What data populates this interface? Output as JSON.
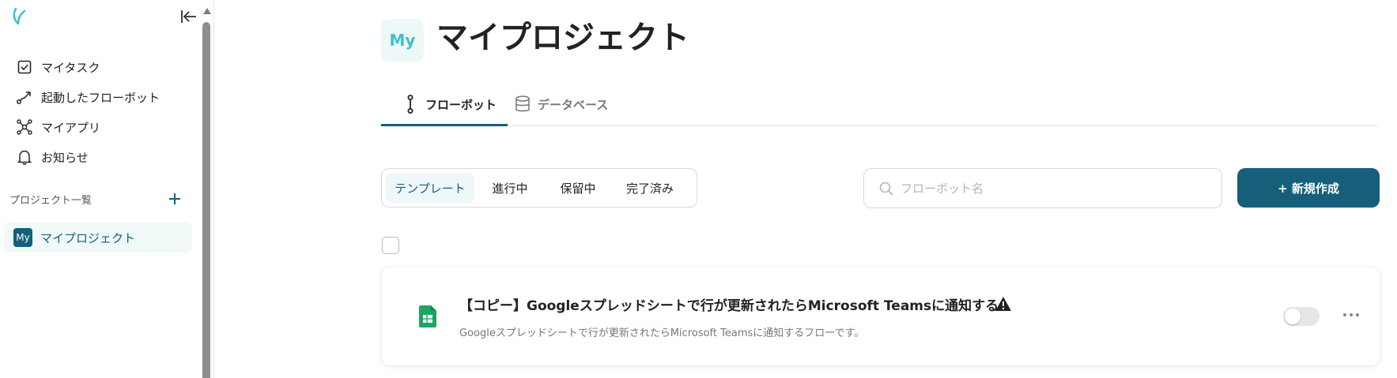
{
  "sidebar": {
    "nav": [
      {
        "label": "マイタスク",
        "icon": "checkbox-icon"
      },
      {
        "label": "起動したフローボット",
        "icon": "flow-icon"
      },
      {
        "label": "マイアプリ",
        "icon": "network-icon"
      },
      {
        "label": "お知らせ",
        "icon": "bell-icon"
      }
    ],
    "projects_header": "プロジェクト一覧",
    "projects": [
      {
        "badge": "My",
        "label": "マイプロジェクト"
      }
    ]
  },
  "page": {
    "avatar": "My",
    "title": "マイプロジェクト"
  },
  "tabs": [
    {
      "label": "フローボット",
      "icon": "flowbot-icon",
      "active": true
    },
    {
      "label": "データベース",
      "icon": "database-icon",
      "active": false
    }
  ],
  "filters": [
    {
      "label": "テンプレート",
      "active": true
    },
    {
      "label": "進行中",
      "active": false
    },
    {
      "label": "保留中",
      "active": false
    },
    {
      "label": "完了済み",
      "active": false
    }
  ],
  "search": {
    "placeholder": "フローボット名",
    "value": ""
  },
  "new_button": {
    "label": "+ 新規作成"
  },
  "flows": [
    {
      "title": "【コピー】Googleスプレッドシートで行が更新されたらMicrosoft Teamsに通知する",
      "description": "Googleスプレッドシートで行が更新されたらMicrosoft Teamsに通知するフローです。",
      "icon": "google-sheets-icon",
      "warning": true,
      "enabled": false
    }
  ],
  "colors": {
    "primary": "#155f7a",
    "accent": "#3ec1cc",
    "active_bg": "#eef8f9",
    "sheets_green": "#1fa463"
  }
}
